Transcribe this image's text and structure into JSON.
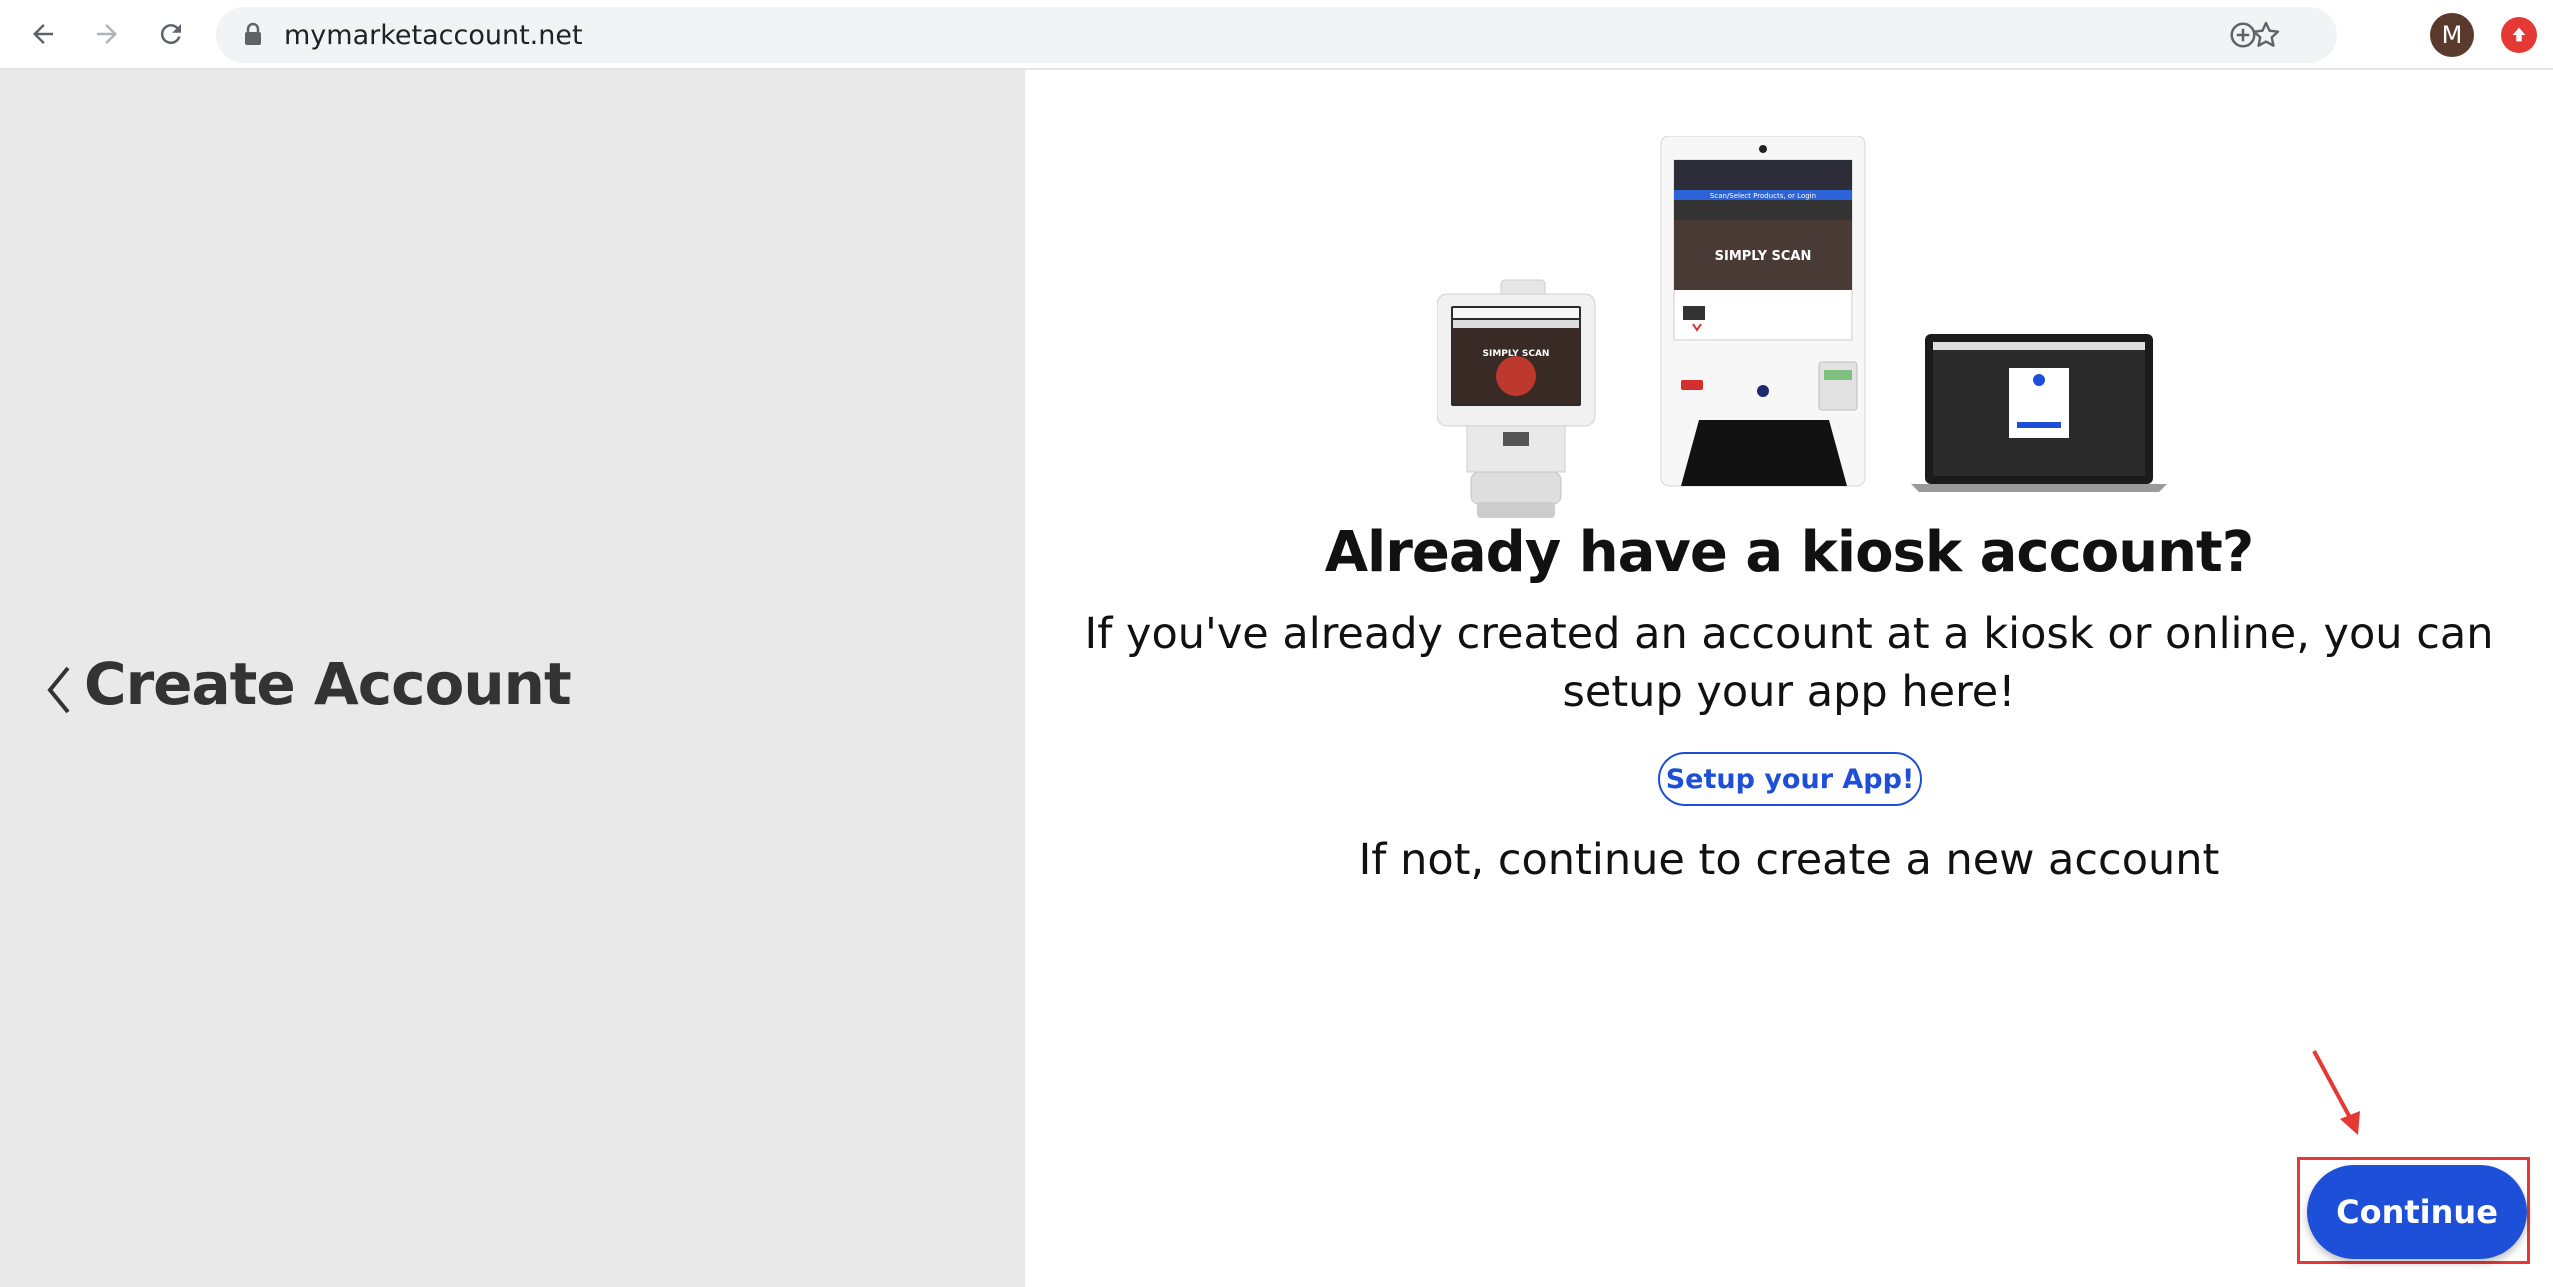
{
  "browser": {
    "url": "mymarketaccount.net",
    "avatar_initial": "M",
    "icons": {
      "back": "back-arrow-icon",
      "forward": "forward-arrow-icon",
      "reload": "reload-icon",
      "lock": "lock-icon",
      "add": "add-circle-icon",
      "bookmark": "star-icon",
      "extension": "upload-icon"
    }
  },
  "sidebar": {
    "title": "Create Account"
  },
  "main": {
    "headline": "Already have a kiosk account?",
    "description": "If you've already created an account at a kiosk or online, you can setup your app here!",
    "setup_button": "Setup your App!",
    "secondary_text": "If not, continue to create a new account",
    "continue_button": "Continue",
    "hero_device_texts": {
      "kiosk_banner": "Scan/Select Products, or Login",
      "kiosk_screen": "SIMPLY SCAN",
      "tablet_screen": "SIMPLY SCAN"
    }
  },
  "colors": {
    "accent": "#1d4fd8",
    "left_panel": "#e9e9e9",
    "highlight": "#e53935"
  }
}
